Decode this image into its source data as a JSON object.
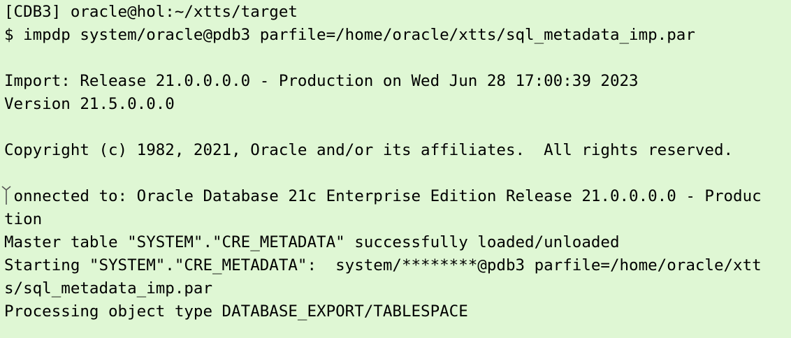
{
  "terminal": {
    "background": "#dff7d4",
    "text_color": "#000000",
    "lines": [
      "[CDB3] oracle@hol:~/xtts/target",
      "$ impdp system/oracle@pdb3 parfile=/home/oracle/xtts/sql_metadata_imp.par",
      "",
      "Import: Release 21.0.0.0.0 - Production on Wed Jun 28 17:00:39 2023",
      "Version 21.5.0.0.0",
      "",
      "Copyright (c) 1982, 2021, Oracle and/or its affiliates.  All rights reserved.",
      "",
      " onnected to: Oracle Database 21c Enterprise Edition Release 21.0.0.0.0 - Produc",
      "tion",
      "Master table \"SYSTEM\".\"CRE_METADATA\" successfully loaded/unloaded",
      "Starting \"SYSTEM\".\"CRE_METADATA\":  system/********@pdb3 parfile=/home/oracle/xtt",
      "s/sql_metadata_imp.par",
      "Processing object type DATABASE_EXPORT/TABLESPACE"
    ]
  }
}
